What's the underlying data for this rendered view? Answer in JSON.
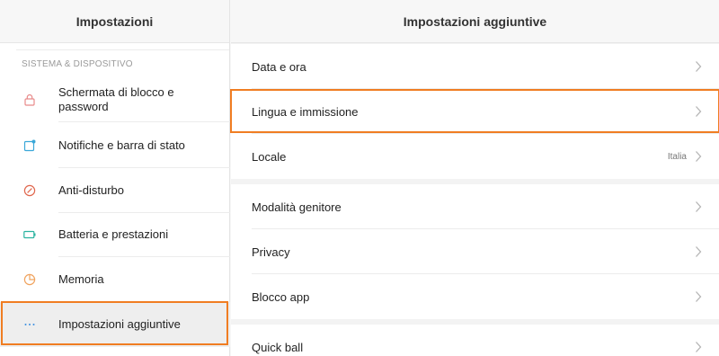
{
  "left_panel": {
    "title": "Impostazioni",
    "section_label": "SISTEMA & DISPOSITIVO",
    "items": [
      {
        "label": "Schermata di blocco e password",
        "icon": "lock-icon",
        "color": "#e88a8a"
      },
      {
        "label": "Notifiche e barra di stato",
        "icon": "notification-icon",
        "color": "#3aa7d8"
      },
      {
        "label": "Anti-disturbo",
        "icon": "do-not-disturb-icon",
        "color": "#e0664c"
      },
      {
        "label": "Batteria e prestazioni",
        "icon": "battery-icon",
        "color": "#2ab3a0"
      },
      {
        "label": "Memoria",
        "icon": "storage-pie-icon",
        "color": "#f0a35e"
      },
      {
        "label": "Impostazioni aggiuntive",
        "icon": "more-dots-icon",
        "color": "#3b8fe0"
      }
    ]
  },
  "right_panel": {
    "title": "Impostazioni aggiuntive",
    "groups": [
      [
        {
          "label": "Data e ora",
          "value": ""
        },
        {
          "label": "Lingua e immissione",
          "value": ""
        },
        {
          "label": "Locale",
          "value": "Italia"
        }
      ],
      [
        {
          "label": "Modalità genitore",
          "value": ""
        },
        {
          "label": "Privacy",
          "value": ""
        },
        {
          "label": "Blocco app",
          "value": ""
        }
      ],
      [
        {
          "label": "Quick ball",
          "value": ""
        }
      ]
    ]
  },
  "colors": {
    "highlight": "#f07d22",
    "chevron": "#b5b5b5"
  }
}
